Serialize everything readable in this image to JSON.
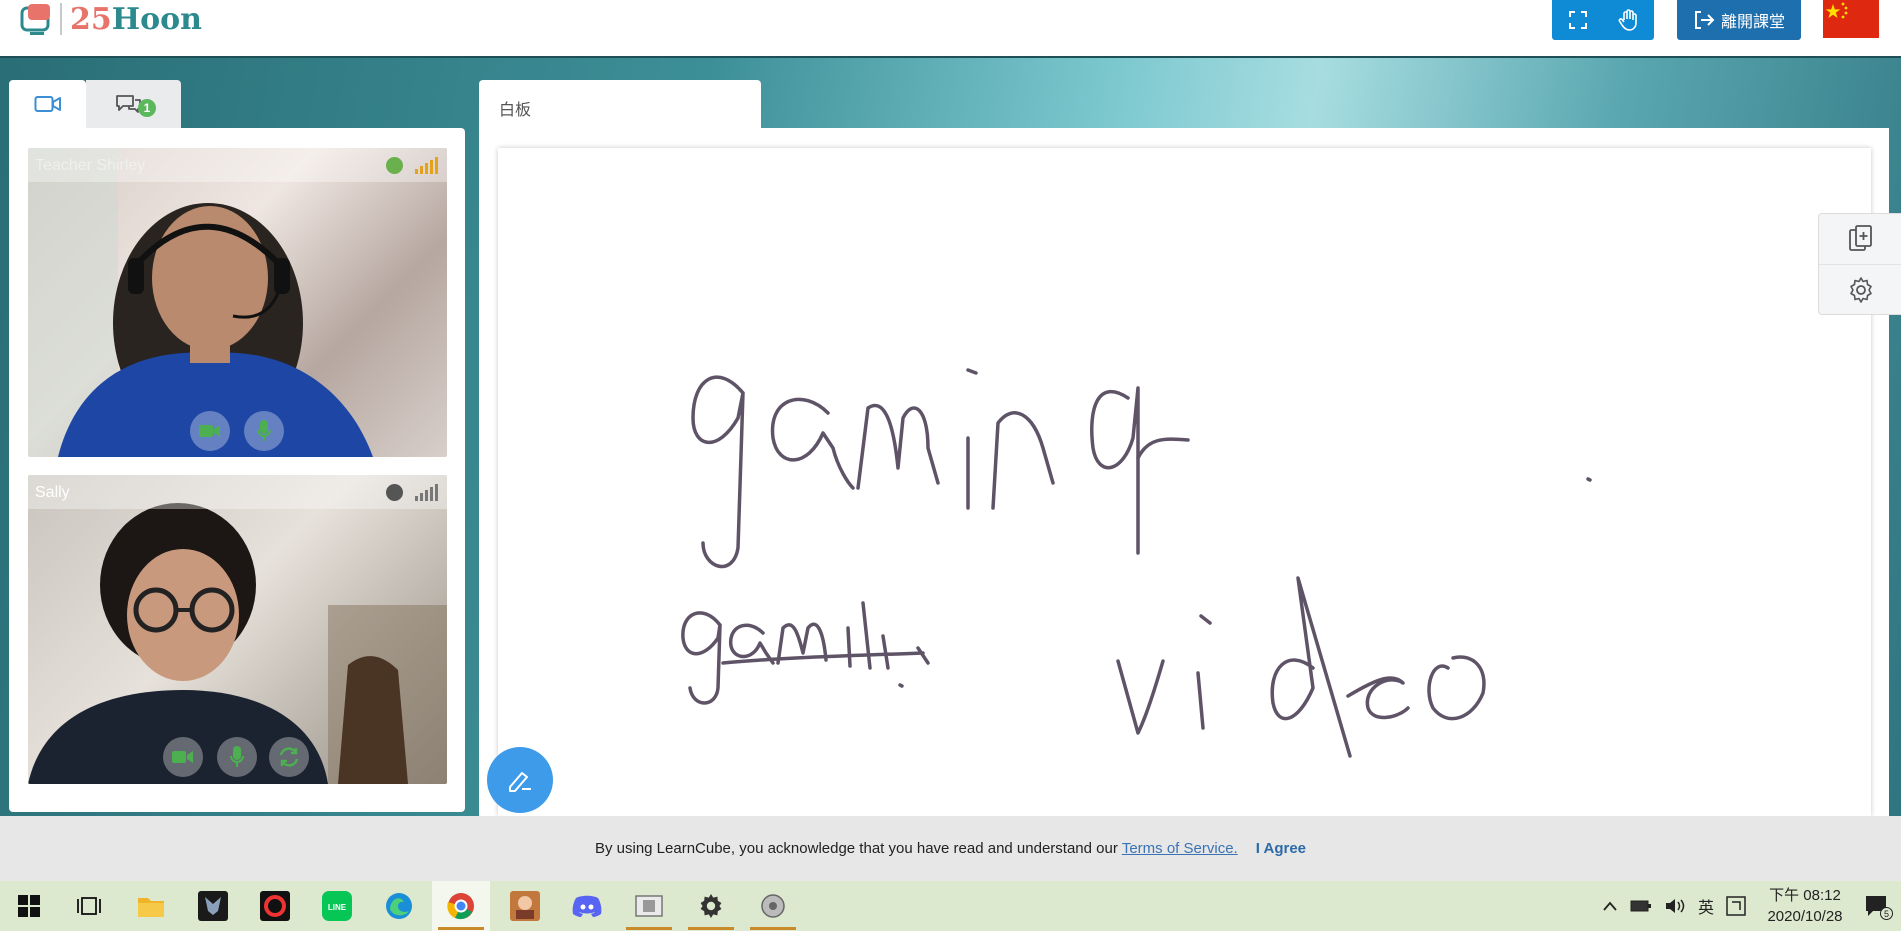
{
  "header": {
    "logo_num": "25",
    "logo_word": "Hoon",
    "leave_label": "離開課堂"
  },
  "left_panel": {
    "chat_badge": "1",
    "videos": [
      {
        "name": "Teacher Shirley",
        "status_color": "#6ab04c",
        "signal_color": "#e3a21a"
      },
      {
        "name": "Sally",
        "status_color": "#555555",
        "signal_color": "#777777"
      }
    ]
  },
  "whiteboard": {
    "tab_label": "白板",
    "handwriting": [
      "gaming",
      "gamiH",
      "video"
    ]
  },
  "cookie_bar": {
    "message": "By using LearnCube, you acknowledge that you have read and understand our",
    "tos_link": "Terms of Service.",
    "agree_label": "I Agree"
  },
  "taskbar": {
    "ime": "英",
    "time": "下午 08:12",
    "date": "2020/10/28",
    "notification_count": "5"
  },
  "colors": {
    "primary_blue": "#0f8bd6",
    "leave_blue": "#1e6fae",
    "pen_blue": "#3d9be9",
    "ink": "#5f5467"
  }
}
